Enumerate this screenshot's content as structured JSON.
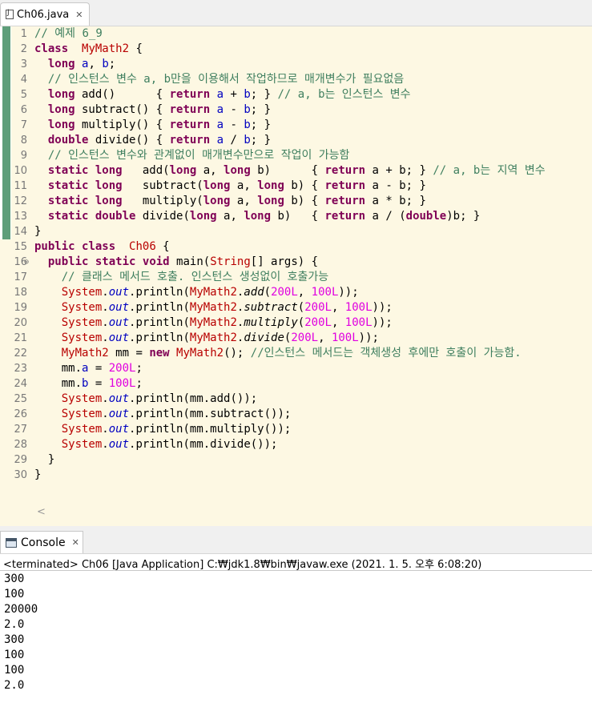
{
  "editor_tab": {
    "title": "Ch06.java",
    "close": "✕",
    "icon": "java-file-icon"
  },
  "editor": {
    "lines": [
      {
        "n": "1",
        "tokens": [
          [
            "cm",
            "// 예제 6_9"
          ]
        ]
      },
      {
        "n": "2",
        "tokens": [
          [
            "kw",
            "class"
          ],
          [
            "",
            "  "
          ],
          [
            "rd",
            "MyMath2"
          ],
          [
            "",
            " {"
          ]
        ]
      },
      {
        "n": "3",
        "tokens": [
          [
            "",
            "  "
          ],
          [
            "kw",
            "long"
          ],
          [
            "",
            " "
          ],
          [
            "fd",
            "a"
          ],
          [
            ", "
          ],
          [
            "fd",
            "b"
          ],
          [
            ";"
          ]
        ]
      },
      {
        "n": "4",
        "tokens": [
          [
            "",
            "  "
          ],
          [
            "cm",
            "// 인스턴스 변수 a, b만을 이용해서 작업하므로 매개변수가 필요없음"
          ]
        ]
      },
      {
        "n": "5",
        "tokens": [
          [
            "",
            "  "
          ],
          [
            "kw",
            "long"
          ],
          [
            "",
            " add()      { "
          ],
          [
            "kw",
            "return"
          ],
          [
            "",
            " "
          ],
          [
            "fd",
            "a"
          ],
          [
            " + "
          ],
          [
            "fd",
            "b"
          ],
          [
            "; } "
          ],
          [
            "cm",
            "// a, b는 인스턴스 변수"
          ]
        ]
      },
      {
        "n": "6",
        "tokens": [
          [
            "",
            "  "
          ],
          [
            "kw",
            "long"
          ],
          [
            "",
            " subtract() { "
          ],
          [
            "kw",
            "return"
          ],
          [
            "",
            " "
          ],
          [
            "fd",
            "a"
          ],
          [
            " - "
          ],
          [
            "fd",
            "b"
          ],
          [
            "; }"
          ]
        ]
      },
      {
        "n": "7",
        "tokens": [
          [
            "",
            "  "
          ],
          [
            "kw",
            "long"
          ],
          [
            "",
            " multiply() { "
          ],
          [
            "kw",
            "return"
          ],
          [
            "",
            " "
          ],
          [
            "fd",
            "a"
          ],
          [
            " - "
          ],
          [
            "fd",
            "b"
          ],
          [
            "; }"
          ]
        ]
      },
      {
        "n": "8",
        "tokens": [
          [
            "",
            "  "
          ],
          [
            "kw",
            "double"
          ],
          [
            "",
            " divide() { "
          ],
          [
            "kw",
            "return"
          ],
          [
            "",
            " "
          ],
          [
            "fd",
            "a"
          ],
          [
            " / "
          ],
          [
            "fd",
            "b"
          ],
          [
            "; }"
          ]
        ]
      },
      {
        "n": "9",
        "tokens": [
          [
            "",
            "  "
          ],
          [
            "cm",
            "// 인스턴스 변수와 관계없이 매개변수만으로 작업이 가능함"
          ]
        ]
      },
      {
        "n": "10",
        "tokens": [
          [
            "",
            "  "
          ],
          [
            "kw",
            "static"
          ],
          [
            "",
            " "
          ],
          [
            "kw",
            "long"
          ],
          [
            "",
            "   add("
          ],
          [
            "kw",
            "long"
          ],
          [
            "",
            " a, "
          ],
          [
            "kw",
            "long"
          ],
          [
            "",
            " b)      { "
          ],
          [
            "kw",
            "return"
          ],
          [
            "",
            " a + b; } "
          ],
          [
            "cm",
            "// a, b는 지역 변수"
          ]
        ]
      },
      {
        "n": "11",
        "tokens": [
          [
            "",
            "  "
          ],
          [
            "kw",
            "static"
          ],
          [
            "",
            " "
          ],
          [
            "kw",
            "long"
          ],
          [
            "",
            "   subtract("
          ],
          [
            "kw",
            "long"
          ],
          [
            "",
            " a, "
          ],
          [
            "kw",
            "long"
          ],
          [
            "",
            " b) { "
          ],
          [
            "kw",
            "return"
          ],
          [
            "",
            " a - b; }"
          ]
        ]
      },
      {
        "n": "12",
        "tokens": [
          [
            "",
            "  "
          ],
          [
            "kw",
            "static"
          ],
          [
            "",
            " "
          ],
          [
            "kw",
            "long"
          ],
          [
            "",
            "   multiply("
          ],
          [
            "kw",
            "long"
          ],
          [
            "",
            " a, "
          ],
          [
            "kw",
            "long"
          ],
          [
            "",
            " b) { "
          ],
          [
            "kw",
            "return"
          ],
          [
            "",
            " a * b; }"
          ]
        ]
      },
      {
        "n": "13",
        "tokens": [
          [
            "",
            "  "
          ],
          [
            "kw",
            "static"
          ],
          [
            "",
            " "
          ],
          [
            "kw",
            "double"
          ],
          [
            "",
            " divide("
          ],
          [
            "kw",
            "long"
          ],
          [
            "",
            " a, "
          ],
          [
            "kw",
            "long"
          ],
          [
            "",
            " b)   { "
          ],
          [
            "kw",
            "return"
          ],
          [
            "",
            " a / ("
          ],
          [
            "kw",
            "double"
          ],
          [
            ")b; }"
          ]
        ]
      },
      {
        "n": "14",
        "tokens": [
          [
            "",
            "}"
          ]
        ]
      },
      {
        "n": "15",
        "tokens": [
          [
            "kw",
            "public"
          ],
          [
            "",
            " "
          ],
          [
            "kw",
            "class"
          ],
          [
            "",
            "  "
          ],
          [
            "rd",
            "Ch06"
          ],
          [
            "",
            " {"
          ]
        ]
      },
      {
        "n": "16",
        "fold": true,
        "tokens": [
          [
            "",
            "  "
          ],
          [
            "kw",
            "public"
          ],
          [
            "",
            " "
          ],
          [
            "kw",
            "static"
          ],
          [
            "",
            " "
          ],
          [
            "kw",
            "void"
          ],
          [
            "",
            " main("
          ],
          [
            "rd",
            "String"
          ],
          [
            "",
            "[] args) {"
          ]
        ]
      },
      {
        "n": "17",
        "tokens": [
          [
            "",
            "    "
          ],
          [
            "cm",
            "// 클래스 메서드 호출. 인스턴스 생성없이 호출가능"
          ]
        ]
      },
      {
        "n": "18",
        "tokens": [
          [
            "",
            "    "
          ],
          [
            "rd",
            "System"
          ],
          [
            "",
            "."
          ],
          [
            "fd it",
            "out"
          ],
          [
            "",
            ".println("
          ],
          [
            "rd",
            "MyMath2"
          ],
          [
            "",
            "."
          ],
          [
            "it",
            "add"
          ],
          [
            "",
            "("
          ],
          [
            "num",
            "200L"
          ],
          [
            "",
            ", "
          ],
          [
            "num",
            "100L"
          ],
          [
            "",
            "));"
          ]
        ]
      },
      {
        "n": "19",
        "tokens": [
          [
            "",
            "    "
          ],
          [
            "rd",
            "System"
          ],
          [
            "",
            "."
          ],
          [
            "fd it",
            "out"
          ],
          [
            "",
            ".println("
          ],
          [
            "rd",
            "MyMath2"
          ],
          [
            "",
            "."
          ],
          [
            "it",
            "subtract"
          ],
          [
            "",
            "("
          ],
          [
            "num",
            "200L"
          ],
          [
            "",
            ", "
          ],
          [
            "num",
            "100L"
          ],
          [
            "",
            "));"
          ]
        ]
      },
      {
        "n": "20",
        "tokens": [
          [
            "",
            "    "
          ],
          [
            "rd",
            "System"
          ],
          [
            "",
            "."
          ],
          [
            "fd it",
            "out"
          ],
          [
            "",
            ".println("
          ],
          [
            "rd",
            "MyMath2"
          ],
          [
            "",
            "."
          ],
          [
            "it",
            "multiply"
          ],
          [
            "",
            "("
          ],
          [
            "num",
            "200L"
          ],
          [
            "",
            ", "
          ],
          [
            "num",
            "100L"
          ],
          [
            "",
            "));"
          ]
        ]
      },
      {
        "n": "21",
        "tokens": [
          [
            "",
            "    "
          ],
          [
            "rd",
            "System"
          ],
          [
            "",
            "."
          ],
          [
            "fd it",
            "out"
          ],
          [
            "",
            ".println("
          ],
          [
            "rd",
            "MyMath2"
          ],
          [
            "",
            "."
          ],
          [
            "it",
            "divide"
          ],
          [
            "",
            "("
          ],
          [
            "num",
            "200L"
          ],
          [
            "",
            ", "
          ],
          [
            "num",
            "100L"
          ],
          [
            "",
            "));"
          ]
        ]
      },
      {
        "n": "22",
        "tokens": [
          [
            "",
            "    "
          ],
          [
            "rd",
            "MyMath2"
          ],
          [
            "",
            " mm = "
          ],
          [
            "kw",
            "new"
          ],
          [
            "",
            " "
          ],
          [
            "rd",
            "MyMath2"
          ],
          [
            "",
            "(); "
          ],
          [
            "cm",
            "//인스턴스 메서드는 객체생성 후에만 호출이 가능함."
          ]
        ]
      },
      {
        "n": "23",
        "tokens": [
          [
            "",
            "    mm."
          ],
          [
            "fd",
            "a"
          ],
          [
            "",
            " = "
          ],
          [
            "num",
            "200L"
          ],
          [
            "",
            ";"
          ]
        ]
      },
      {
        "n": "24",
        "tokens": [
          [
            "",
            "    mm."
          ],
          [
            "fd",
            "b"
          ],
          [
            "",
            " = "
          ],
          [
            "num",
            "100L"
          ],
          [
            "",
            ";"
          ]
        ]
      },
      {
        "n": "25",
        "tokens": [
          [
            "",
            "    "
          ],
          [
            "rd",
            "System"
          ],
          [
            "",
            "."
          ],
          [
            "fd it",
            "out"
          ],
          [
            "",
            ".println(mm.add());"
          ]
        ]
      },
      {
        "n": "26",
        "tokens": [
          [
            "",
            "    "
          ],
          [
            "rd",
            "System"
          ],
          [
            "",
            "."
          ],
          [
            "fd it",
            "out"
          ],
          [
            "",
            ".println(mm.subtract());"
          ]
        ]
      },
      {
        "n": "27",
        "tokens": [
          [
            "",
            "    "
          ],
          [
            "rd",
            "System"
          ],
          [
            "",
            "."
          ],
          [
            "fd it",
            "out"
          ],
          [
            "",
            ".println(mm.multiply());"
          ]
        ]
      },
      {
        "n": "28",
        "tokens": [
          [
            "",
            "    "
          ],
          [
            "rd",
            "System"
          ],
          [
            "",
            "."
          ],
          [
            "fd it",
            "out"
          ],
          [
            "",
            ".println(mm.divide());"
          ]
        ]
      },
      {
        "n": "29",
        "tokens": [
          [
            "",
            "  }"
          ]
        ]
      },
      {
        "n": "30",
        "tokens": [
          [
            "",
            "}"
          ]
        ]
      }
    ],
    "scroll_left": "<",
    "fold_icon": "⊖"
  },
  "console_tab": {
    "title": "Console",
    "close": "✕",
    "icon": "console-icon"
  },
  "console": {
    "status": "<terminated> Ch06 [Java Application] C:₩jdk1.8₩bin₩javaw.exe (2021. 1. 5. 오후 6:08:20)",
    "output": [
      "300",
      "100",
      "20000",
      "2.0",
      "300",
      "100",
      "100",
      "2.0"
    ]
  }
}
